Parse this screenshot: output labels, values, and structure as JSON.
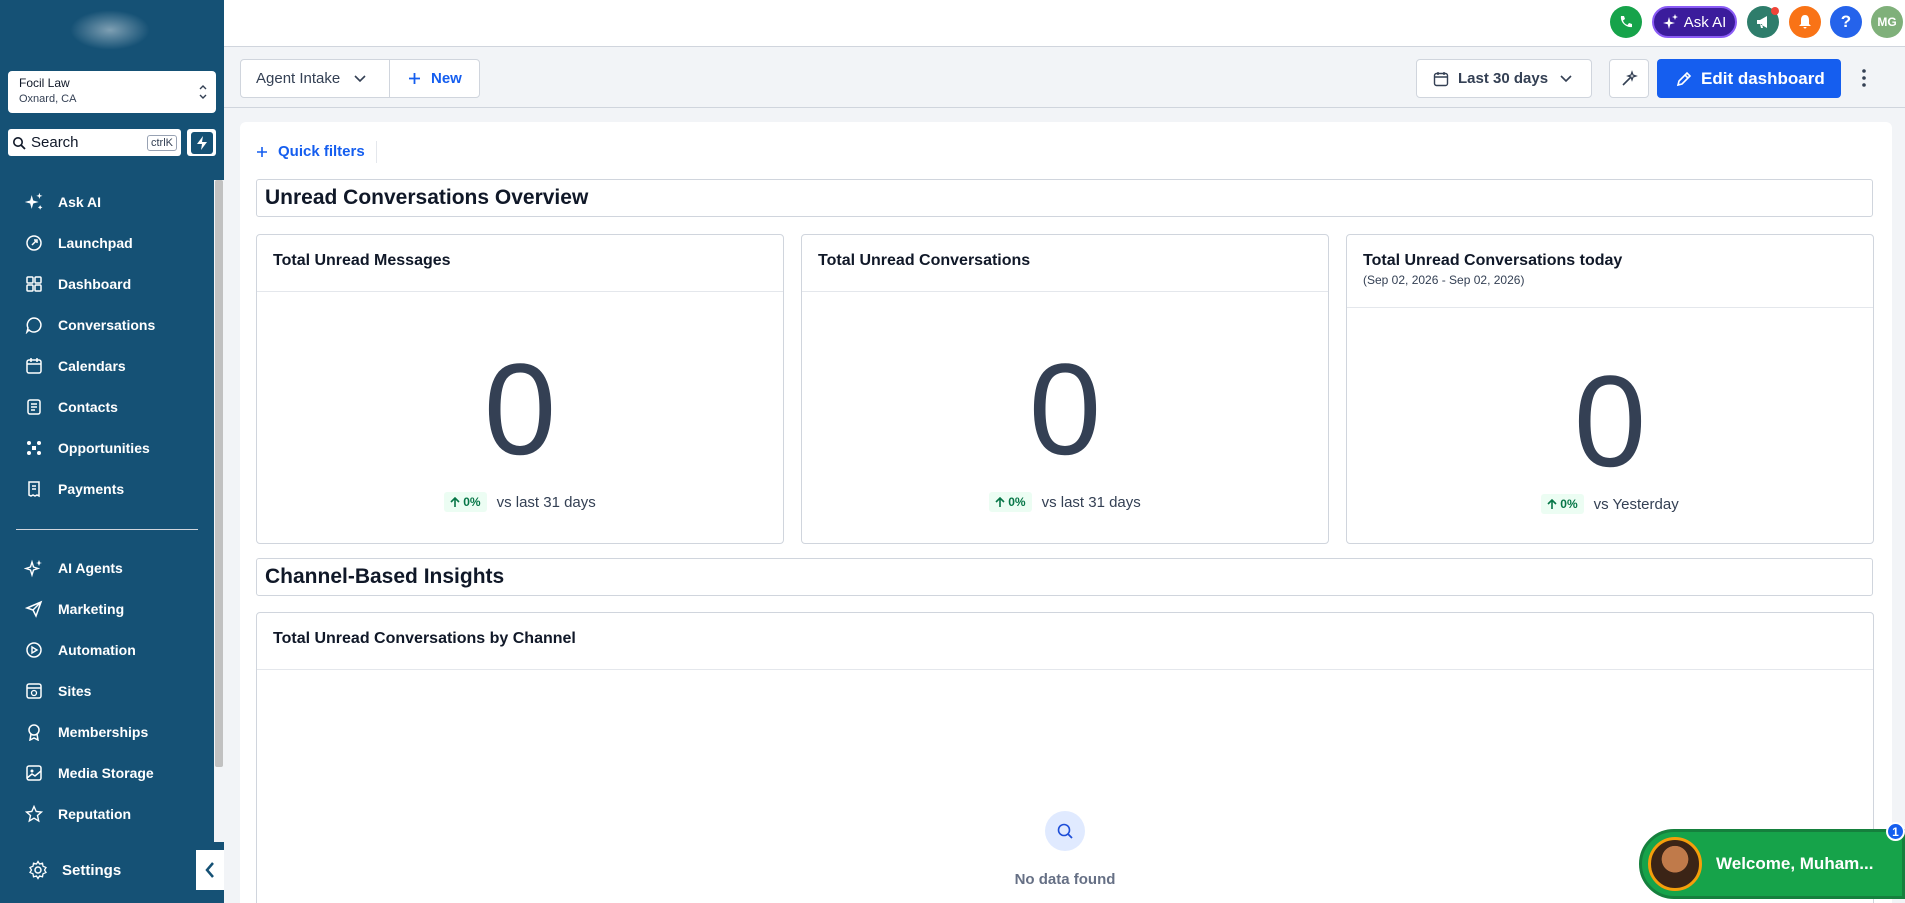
{
  "location": {
    "name": "Focil Law",
    "city": "Oxnard, CA"
  },
  "search": {
    "label": "Search",
    "shortcut": "ctrlK"
  },
  "sidebar": {
    "items": [
      {
        "label": "Ask AI",
        "icon": "sparkle-icon"
      },
      {
        "label": "Launchpad",
        "icon": "rocket-icon"
      },
      {
        "label": "Dashboard",
        "icon": "grid-icon"
      },
      {
        "label": "Conversations",
        "icon": "chat-icon"
      },
      {
        "label": "Calendars",
        "icon": "calendar-icon"
      },
      {
        "label": "Contacts",
        "icon": "contacts-icon"
      },
      {
        "label": "Opportunities",
        "icon": "opportunities-icon"
      },
      {
        "label": "Payments",
        "icon": "payments-icon"
      }
    ],
    "items2": [
      {
        "label": "AI Agents",
        "icon": "ai-agents-icon"
      },
      {
        "label": "Marketing",
        "icon": "send-icon"
      },
      {
        "label": "Automation",
        "icon": "automation-icon"
      },
      {
        "label": "Sites",
        "icon": "sites-icon"
      },
      {
        "label": "Memberships",
        "icon": "award-icon"
      },
      {
        "label": "Media Storage",
        "icon": "image-icon"
      },
      {
        "label": "Reputation",
        "icon": "star-icon"
      }
    ],
    "settings": "Settings"
  },
  "topbar": {
    "ask_ai": "Ask AI",
    "avatar_initials": "MG"
  },
  "toolbar": {
    "dashboard_select": "Agent Intake",
    "new_label": "New",
    "date_range": "Last 30 days",
    "edit_label": "Edit dashboard"
  },
  "main": {
    "quick_filters": "Quick filters",
    "section1": "Unread Conversations Overview",
    "cards": [
      {
        "title": "Total Unread Messages",
        "subtitle": "",
        "value": "0",
        "change": "0%",
        "compare": "vs last 31 days"
      },
      {
        "title": "Total Unread Conversations",
        "subtitle": "",
        "value": "0",
        "change": "0%",
        "compare": "vs last 31 days"
      },
      {
        "title": "Total Unread Conversations today",
        "subtitle": "(Sep 02, 2026 - Sep 02, 2026)",
        "value": "0",
        "change": "0%",
        "compare": "vs Yesterday"
      }
    ],
    "section2": "Channel-Based Insights",
    "channel_card": {
      "title": "Total Unread Conversations by Channel",
      "empty": "No data found"
    }
  },
  "welcome": {
    "text": "Welcome, Muham...",
    "badge": "1"
  },
  "colors": {
    "sidebar": "#155175",
    "accent": "#155eef",
    "ask_ai": "#3b1c9c",
    "success": "#067647"
  }
}
